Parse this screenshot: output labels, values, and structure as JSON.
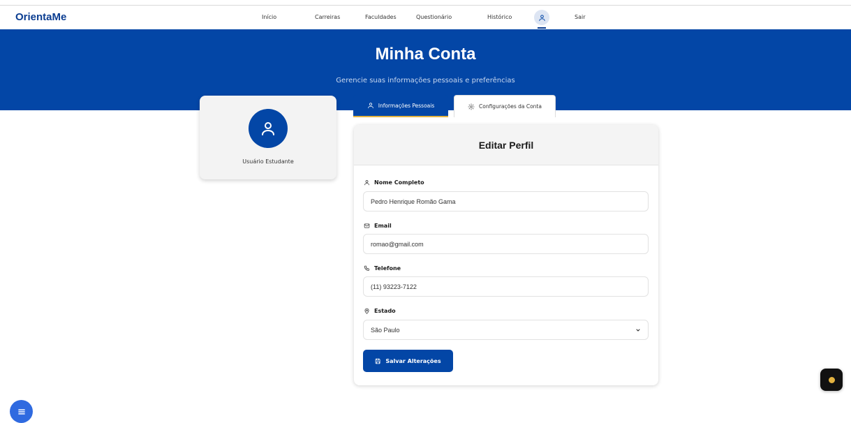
{
  "brand": "OrientaMe",
  "nav": {
    "links": [
      "Início",
      "Carreiras",
      "Faculdades",
      "Questionário",
      "Histórico",
      "Sair"
    ]
  },
  "hero": {
    "title": "Minha Conta",
    "subtitle": "Gerencie suas informações pessoais e preferências"
  },
  "profile": {
    "name": "Usuário Estudante"
  },
  "tabs": [
    {
      "label": "Informações Pessoais",
      "active": true
    },
    {
      "label": "Configurações da Conta",
      "active": false
    }
  ],
  "form": {
    "title": "Editar Perfil",
    "fields": [
      {
        "label": "Nome Completo",
        "value": "Pedro Henrique Romão Gama",
        "icon": "user-icon"
      },
      {
        "label": "Email",
        "value": "romao@gmail.com",
        "icon": "mail-icon"
      },
      {
        "label": "Telefone",
        "value": "(11) 93223-7122",
        "icon": "phone-icon"
      },
      {
        "label": "Estado",
        "value": "São Paulo",
        "icon": "location-pin-icon"
      }
    ],
    "save_label": "Salvar Alterações"
  },
  "colors": {
    "primary": "#0346a6",
    "brand": "#0b3d91",
    "accent": "#e3b341"
  }
}
